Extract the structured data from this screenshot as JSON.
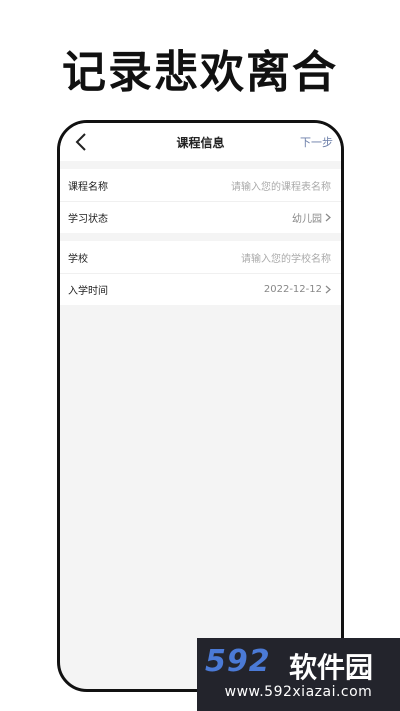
{
  "promo": {
    "title": "记录悲欢离合"
  },
  "nav": {
    "title": "课程信息",
    "next_label": "下一步"
  },
  "form": {
    "group1": [
      {
        "label": "课程名称",
        "placeholder": "请输入您的课程表名称",
        "value": ""
      },
      {
        "label": "学习状态",
        "value": "幼儿园"
      }
    ],
    "group2": [
      {
        "label": "学校",
        "placeholder": "请输入您的学校名称",
        "value": ""
      },
      {
        "label": "入学时间",
        "value": "2022-12-12"
      }
    ]
  },
  "watermark": {
    "brand_number": "592",
    "brand_text": "软件园",
    "url": "www.592xiazai.com"
  },
  "colors": {
    "accent": "#6b7ea8",
    "page_bg": "#f4f4f4",
    "watermark_bg": "#23242c",
    "watermark_blue": "#4b7ad6"
  }
}
